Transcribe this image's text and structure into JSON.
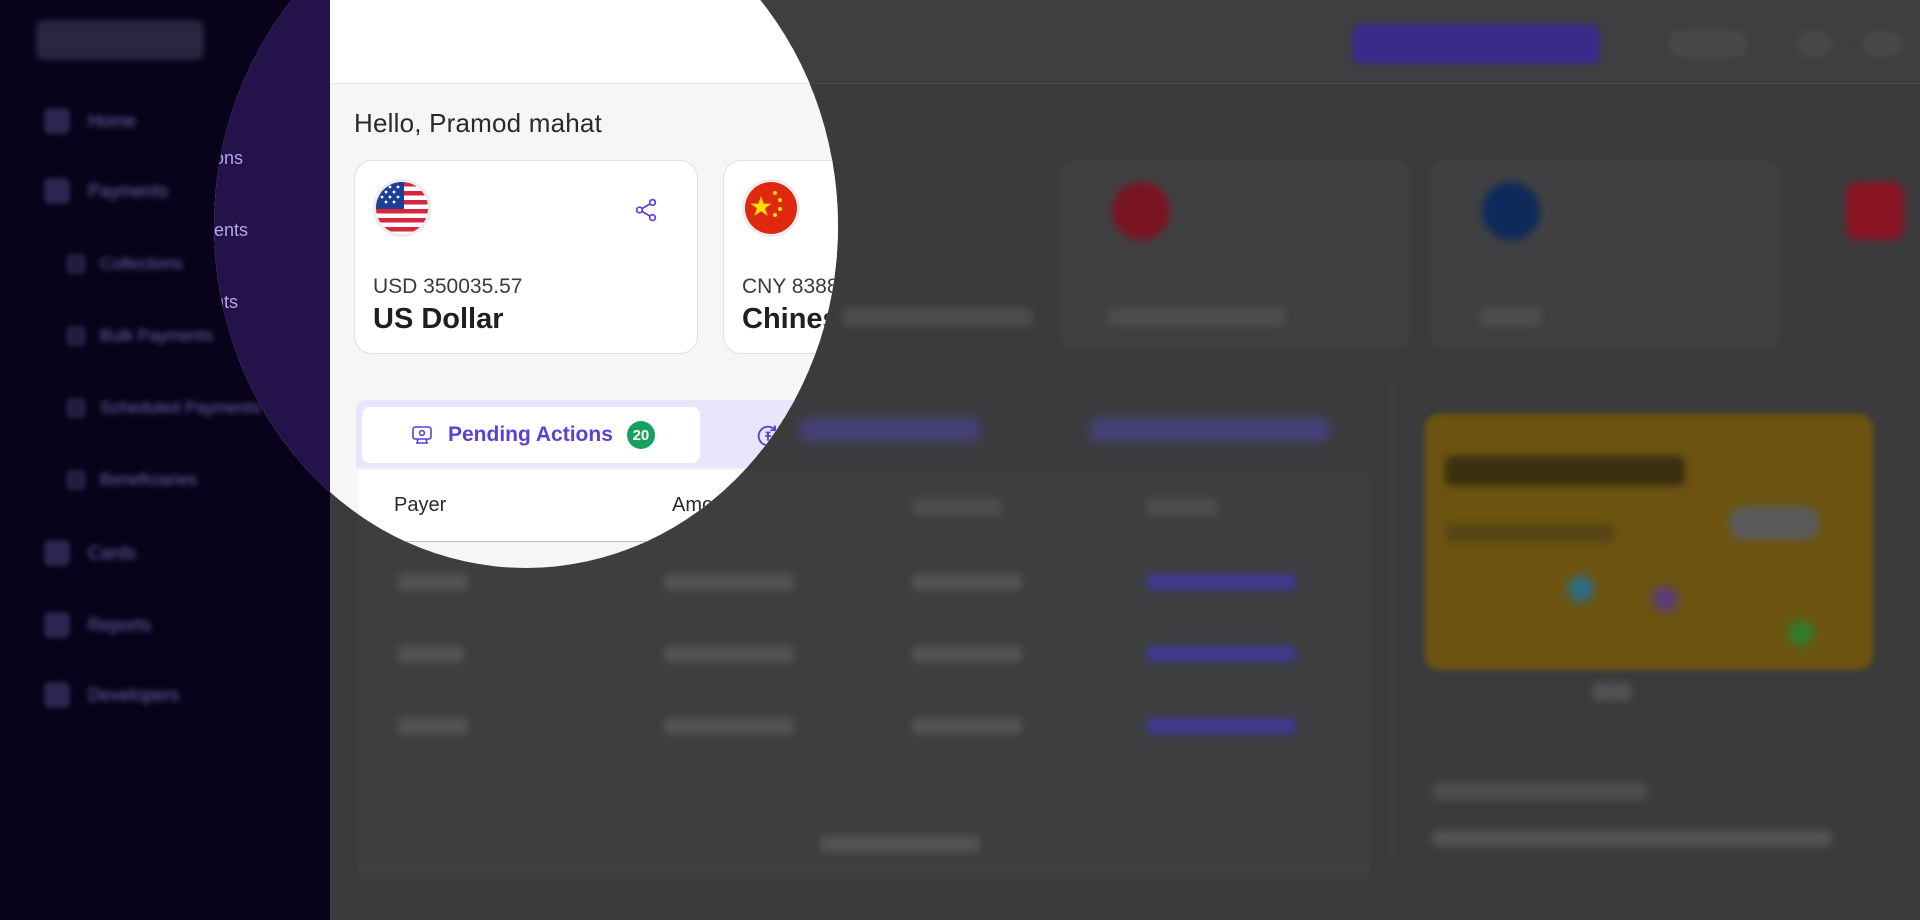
{
  "sidebar": {
    "items": [
      {
        "label": "Home"
      },
      {
        "label": "Payments"
      },
      {
        "label": "Collections",
        "visible_text": "ons"
      },
      {
        "label": "Bulk Payments",
        "visible_text": "ents"
      },
      {
        "label": "Scheduled Payments",
        "visible_text": "nts"
      },
      {
        "label": "Beneficiaries"
      },
      {
        "label": "Cards"
      },
      {
        "label": "Reports"
      },
      {
        "label": "Developers"
      }
    ]
  },
  "header": {
    "greeting": "Hello, Pramod mahat"
  },
  "currencies": [
    {
      "code_amount": "USD 350035.57",
      "name": "US Dollar",
      "flag": "us-flag"
    },
    {
      "code_amount": "CNY 8388",
      "name": "Chines",
      "flag": "china-flag"
    }
  ],
  "tabs": [
    {
      "label": "Pending Actions",
      "count": "20",
      "icon": "review-icon"
    },
    {
      "icon": "exchange-icon"
    }
  ],
  "table": {
    "columns": [
      "Payer",
      "Amo"
    ]
  },
  "colors": {
    "accent": "#5b3fd6",
    "badge": "#17a05e",
    "sidebar": "#24124a",
    "overlay": "#3b3b3d"
  }
}
